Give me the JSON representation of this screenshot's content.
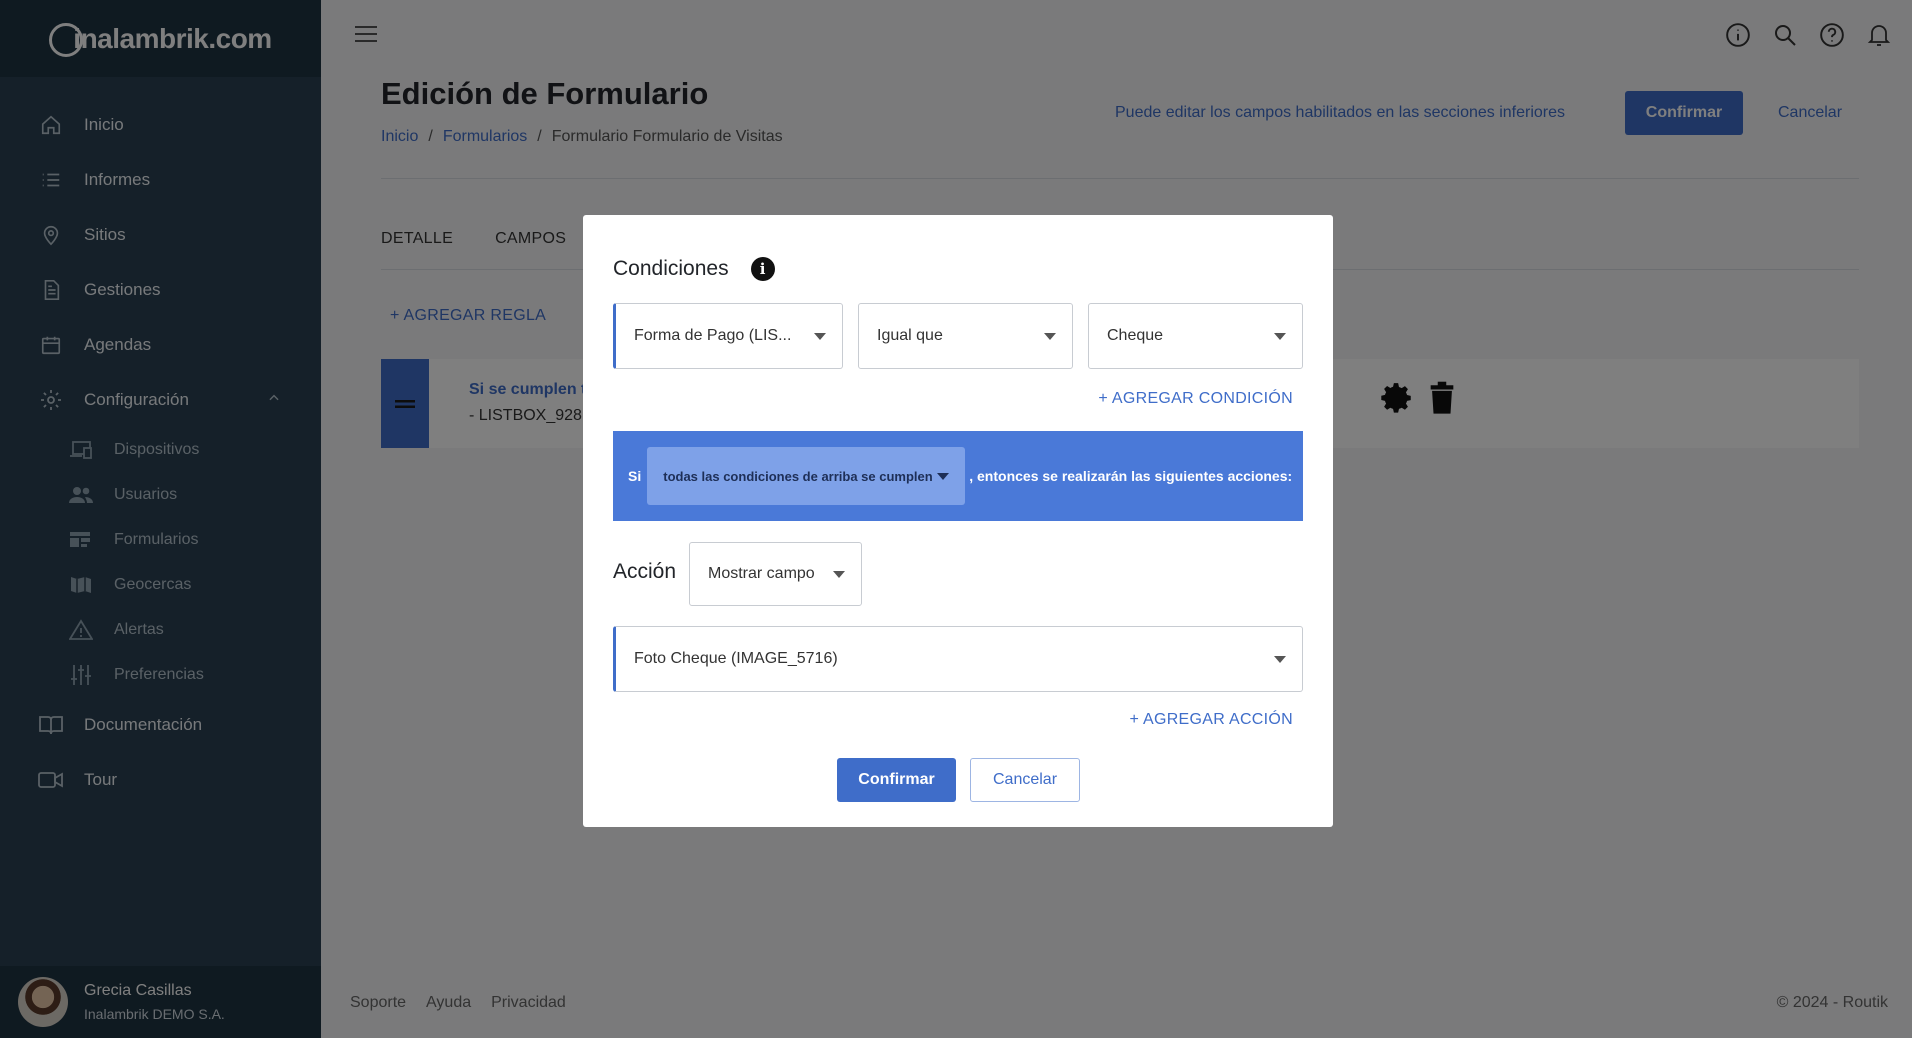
{
  "brand": {
    "logo_text": "inalambrik.com"
  },
  "sidebar": {
    "items": [
      {
        "label": "Inicio",
        "icon": "home-icon"
      },
      {
        "label": "Informes",
        "icon": "list-icon"
      },
      {
        "label": "Sitios",
        "icon": "location-pin-icon"
      },
      {
        "label": "Gestiones",
        "icon": "document-icon"
      },
      {
        "label": "Agendas",
        "icon": "calendar-icon"
      },
      {
        "label": "Configuración",
        "icon": "gear-icon"
      }
    ],
    "sub_items": [
      {
        "label": "Dispositivos",
        "icon": "devices-icon"
      },
      {
        "label": "Usuarios",
        "icon": "users-icon"
      },
      {
        "label": "Formularios",
        "icon": "forms-icon"
      },
      {
        "label": "Geocercas",
        "icon": "map-icon"
      },
      {
        "label": "Alertas",
        "icon": "warning-icon"
      },
      {
        "label": "Preferencias",
        "icon": "sliders-icon"
      }
    ],
    "bottom_items": [
      {
        "label": "Documentación",
        "icon": "book-icon"
      },
      {
        "label": "Tour",
        "icon": "video-icon"
      }
    ],
    "user": {
      "name": "Grecia Casillas",
      "org": "Inalambrik DEMO S.A."
    }
  },
  "header": {
    "title": "Edición de Formulario",
    "breadcrumb": [
      "Inicio",
      "Formularios",
      "Formulario Formulario de Visitas"
    ],
    "hint": "Puede editar los campos habilitados en las secciones inferiores",
    "confirm_label": "Confirmar",
    "cancel_label": "Cancelar"
  },
  "tabs": [
    "DETALLE",
    "CAMPOS"
  ],
  "add_rule_label": "+ AGREGAR REGLA",
  "rule": {
    "summary": "Si se cumplen t",
    "detail": "- LISTBOX_928"
  },
  "footer": {
    "links": [
      "Soporte",
      "Ayuda",
      "Privacidad"
    ],
    "copyright": "© 2024 - Routik"
  },
  "modal": {
    "title": "Condiciones",
    "condition": {
      "field": "Forma de Pago (LIS...",
      "operator": "Igual que",
      "value": "Cheque"
    },
    "add_condition_label": "+ AGREGAR CONDICIÓN",
    "banner": {
      "prefix": "Si",
      "selector": "todas las condiciones de arriba se cumplen",
      "suffix": ", entonces se realizarán las siguientes acciones:"
    },
    "action_label": "Acción",
    "action_value": "Mostrar campo",
    "target_field": "Foto Cheque (IMAGE_5716)",
    "add_action_label": "+ AGREGAR ACCIÓN",
    "confirm_label": "Confirmar",
    "cancel_label": "Cancelar"
  },
  "colors": {
    "sidebar": "#2a4152",
    "accent": "#3f6dc9",
    "banner": "#4a79d8"
  }
}
